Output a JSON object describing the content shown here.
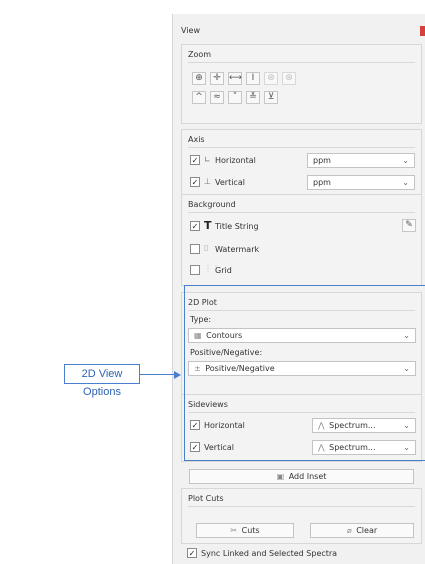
{
  "panel": {
    "title": "View"
  },
  "zoom": {
    "title": "Zoom",
    "row1": [
      {
        "icon": "zoom-in-icon",
        "glyph": "⊕"
      },
      {
        "icon": "crosshair-icon",
        "glyph": "✛"
      },
      {
        "icon": "horizontal-fit-icon",
        "glyph": "⟷"
      },
      {
        "icon": "vertical-fit-icon",
        "glyph": "I"
      },
      {
        "icon": "zoom-tool-icon",
        "glyph": "⊛"
      },
      {
        "icon": "zoom-reset-icon",
        "glyph": "⊛"
      }
    ],
    "row2": [
      {
        "icon": "chevron-up-icon",
        "glyph": "^"
      },
      {
        "icon": "double-chevron-up-icon",
        "glyph": "≈"
      },
      {
        "icon": "chevron-down-icon",
        "glyph": "˅"
      },
      {
        "icon": "double-chevron-down-icon",
        "glyph": "≚"
      },
      {
        "icon": "fit-all-icon",
        "glyph": "⊻"
      }
    ]
  },
  "axis": {
    "title": "Axis",
    "horizontal": {
      "label": "Horizontal",
      "value": "ppm",
      "checked": true
    },
    "vertical": {
      "label": "Vertical",
      "value": "ppm",
      "checked": true
    }
  },
  "background": {
    "title": "Background",
    "title_string": {
      "label": "Title String",
      "checked": true
    },
    "watermark": {
      "label": "Watermark",
      "checked": false
    },
    "grid": {
      "label": "Grid",
      "checked": false
    }
  },
  "plot2d": {
    "title": "2D Plot",
    "type_label": "Type:",
    "type_value": "Contours",
    "posneg_label": "Positive/Negative:",
    "posneg_value": "Positive/Negative"
  },
  "sideviews": {
    "title": "Sideviews",
    "horizontal": {
      "label": "Horizontal",
      "value": "Spectrum...",
      "checked": true
    },
    "vertical": {
      "label": "Vertical",
      "value": "Spectrum...",
      "checked": true
    }
  },
  "add_inset": "Add Inset",
  "plot_cuts": {
    "title": "Plot Cuts",
    "cuts": "Cuts",
    "clear": "Clear"
  },
  "sync": {
    "label": "Sync Linked and Selected Spectra",
    "checked": true
  },
  "callout": {
    "label": "2D View Options"
  },
  "colors": {
    "accent": "#4a7fcf",
    "close": "#d5403b"
  }
}
